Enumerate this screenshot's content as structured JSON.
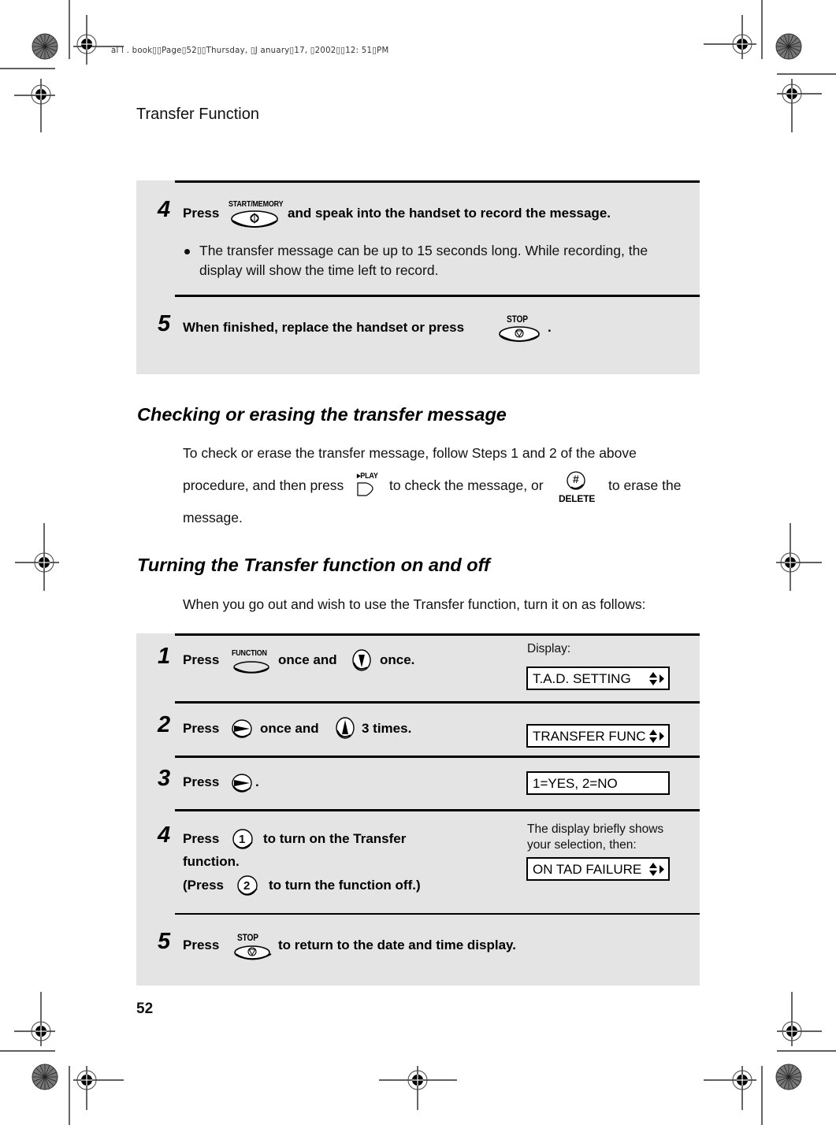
{
  "print_header": "al l . book▯▯Page▯52▯▯Thursday, ▯J anuary▯17, ▯2002▯▯12: 51▯PM",
  "running_head": "Transfer Function",
  "page_number": "52",
  "colors": {
    "panel_background": "#e4e4e4",
    "rule": "#000000",
    "text": "#111111"
  },
  "recording_steps": [
    {
      "number": "4",
      "parts": [
        "Press",
        "and speak into the handset to record the message."
      ],
      "key": {
        "label": "START/MEMORY",
        "icon": "start-memory-key-icon"
      },
      "bullet": "The transfer message can be up to 15 seconds long. While recording, the display will show the time left to record."
    },
    {
      "number": "5",
      "parts": [
        "When finished, replace the handset or press",
        "."
      ],
      "key": {
        "label": "STOP",
        "icon": "stop-key-icon"
      }
    }
  ],
  "checking_section": {
    "title": "Checking or erasing the transfer message",
    "line1": "To check or erase the transfer message, follow Steps 1 and 2 of the above",
    "line2_a": "procedure, and then press",
    "play_key_label": "▸PLAY",
    "line2_b": "to check the message, or",
    "delete_key_symbol": "#",
    "delete_key_label": "DELETE",
    "line2_c": "to erase the",
    "line3": "message."
  },
  "turning_section": {
    "title": "Turning the Transfer function on and off",
    "intro": "When you go out and wish to use the Transfer function, turn it on as follows:"
  },
  "setup_steps": [
    {
      "number": "1",
      "press": "Press",
      "key1_label": "FUNCTION",
      "mid": "once and",
      "end": "once.",
      "display_caption": "Display:",
      "display": "T.A.D. SETTING"
    },
    {
      "number": "2",
      "press": "Press",
      "mid": "once and",
      "end": "3 times.",
      "display": "TRANSFER FUNC"
    },
    {
      "number": "3",
      "press": "Press",
      "end": ".",
      "display": "1=YES, 2=NO"
    },
    {
      "number": "4",
      "press": "Press",
      "key1": "1",
      "line1_end": "to turn on the Transfer",
      "line2": "function.",
      "line3_a": "(Press",
      "key2": "2",
      "line3_b": "to turn the function off.)",
      "display_caption": "The display briefly shows your selection, then:",
      "display_caption_line1": "The display briefly shows",
      "display_caption_line2": "your selection, then:",
      "display": "ON TAD FAILURE"
    },
    {
      "number": "5",
      "press": "Press",
      "key_label": "STOP",
      "end": "to return to the date and time display."
    }
  ]
}
